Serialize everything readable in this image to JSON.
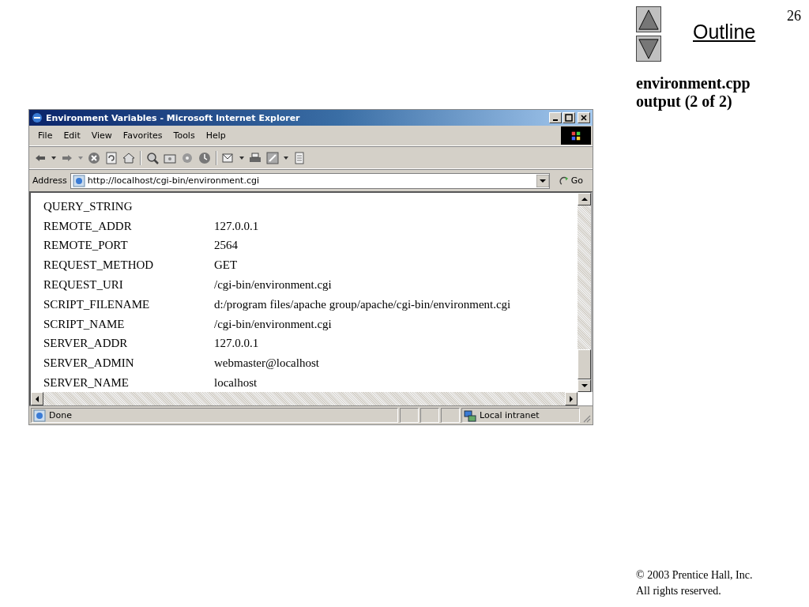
{
  "slide": {
    "page_number": "26",
    "outline_link": "Outline",
    "caption_lines": [
      "environment.cpp",
      "output (2 of 2)"
    ],
    "copyright": "2003 Prentice Hall, Inc.",
    "copyright_symbol": "©",
    "rights": "All rights reserved."
  },
  "window": {
    "title": "Environment Variables - Microsoft Internet Explorer",
    "menu": [
      "File",
      "Edit",
      "View",
      "Favorites",
      "Tools",
      "Help"
    ],
    "address_label": "Address",
    "address": "http://localhost/cgi-bin/environment.cgi",
    "go_button": "Go",
    "rows": [
      {
        "name": "QUERY_STRING"
      },
      {
        "name": "REMOTE_ADDR",
        "value": "127.0.0.1"
      },
      {
        "name": "REMOTE_PORT",
        "value": "2564"
      },
      {
        "name": "REQUEST_METHOD",
        "value": "GET"
      },
      {
        "name": "REQUEST_URI",
        "value": "/cgi-bin/environment.cgi"
      },
      {
        "name": "SCRIPT_FILENAME",
        "value": "d:/program files/apache group/apache/cgi-bin/environment.cgi"
      },
      {
        "name": "SCRIPT_NAME",
        "value": "/cgi-bin/environment.cgi"
      },
      {
        "name": "SERVER_ADDR",
        "value": "127.0.0.1"
      },
      {
        "name": "SERVER_ADMIN",
        "value": "webmaster@localhost"
      },
      {
        "name": "SERVER_NAME",
        "value": "localhost"
      }
    ],
    "status": "Done",
    "zone": "Local intranet"
  }
}
